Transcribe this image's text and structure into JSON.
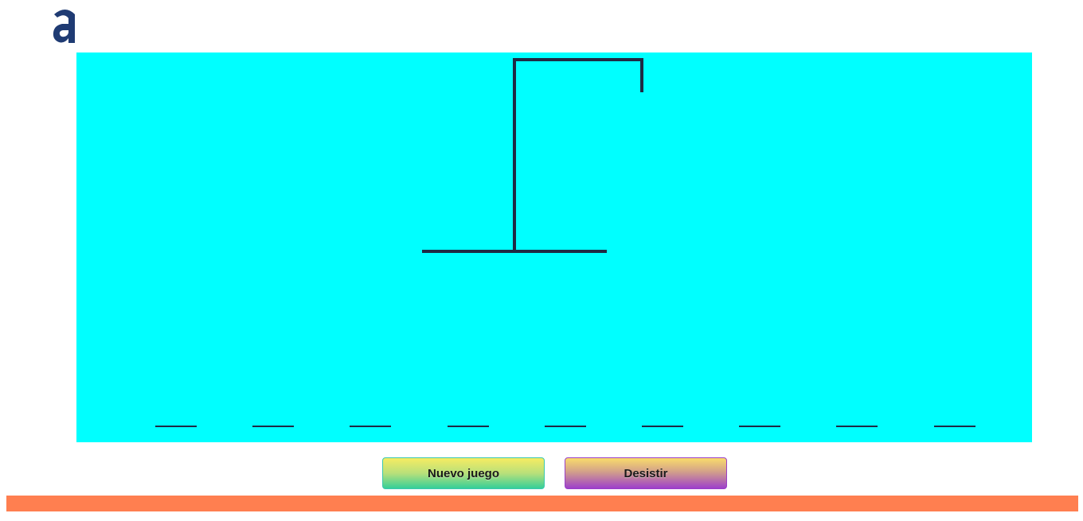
{
  "logo": {
    "icon": "brand-a-logo-icon",
    "color": "#1f3b73"
  },
  "board": {
    "background": "#00ffff",
    "word_slots": 9,
    "stroke_color": "#1f2a44"
  },
  "buttons": {
    "new_game_label": "Nuevo juego",
    "give_up_label": "Desistir"
  },
  "footer": {
    "color": "#ff7f50"
  }
}
